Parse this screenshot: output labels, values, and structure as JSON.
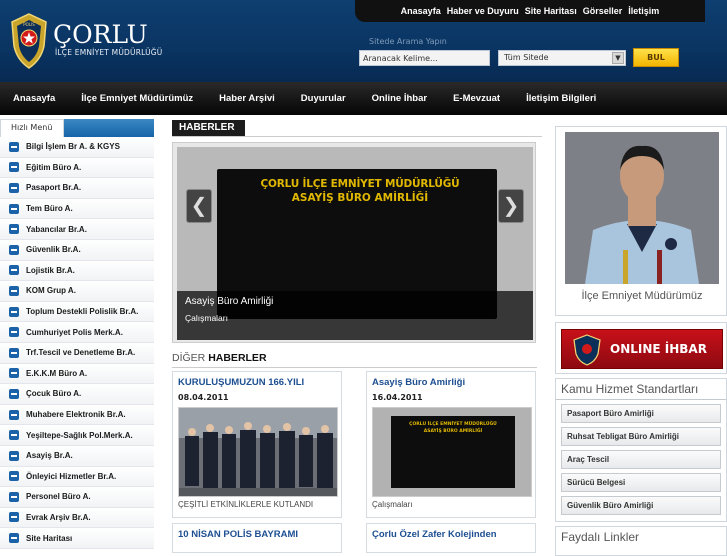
{
  "header": {
    "title": "ÇORLU",
    "subtitle": "İLÇE EMNİYET MÜDÜRLÜĞÜ",
    "badge_text": "POLIS"
  },
  "top_nav": [
    "Anasayfa",
    "Haber ve Duyuru",
    "Site Haritası",
    "Görseller",
    "İletişim"
  ],
  "search": {
    "label": "Sitede Arama Yapın",
    "input_value": "Aranacak Kelime...",
    "scope_selected": "Tüm Sitede",
    "button_label": "BUL"
  },
  "main_nav": [
    "Anasayfa",
    "İlçe Emniyet Müdürümüz",
    "Haber Arşivi",
    "Duyurular",
    "Online İhbar",
    "E-Mevzuat",
    "İletişim Bilgileri"
  ],
  "sidebar": {
    "tab_label": "Hızlı Menü",
    "items": [
      "Bilgi İşlem Br A. & KGYS",
      "Eğitim Büro A.",
      "Pasaport Br.A.",
      "Tem Büro A.",
      "Yabancılar Br.A.",
      "Güvenlik Br.A.",
      "Lojistik Br.A.",
      "KOM Grup A.",
      "Toplum Destekli Polislik Br.A.",
      "Cumhuriyet Polis Merk.A.",
      "Trf.Tescil ve Denetleme Br.A.",
      "E.K.K.M Büro A.",
      "Çocuk Büro A.",
      "Muhabere Elektronik Br.A.",
      "Yeşiltepe-Sağlık Pol.Merk.A.",
      "Asayiş Br.A.",
      "Önleyici Hizmetler Br.A.",
      "Personel Büro A.",
      "Evrak Arşiv Br.A.",
      "Site Haritası"
    ]
  },
  "news": {
    "section_title": "HABERLER",
    "slide": {
      "screen_line1": "ÇORLU İLÇE EMNİYET MÜDÜRLÜĞÜ",
      "screen_line2": "ASAYİŞ BÜRO AMİRLİĞİ",
      "title": "Asayiş Büro Amirliği",
      "subtitle": "Çalışmaları",
      "prev_icon": "❮",
      "next_icon": "❯"
    },
    "other_prefix": "DİĞER",
    "other_title": "HABERLER",
    "cards": [
      {
        "title": "KURULUŞUMUZUN 166.YILI",
        "date": "08.04.2011",
        "caption": "ÇEŞİTLİ ETKİNLİKLERLE KUTLANDI"
      },
      {
        "title": "Asayiş Büro Amirliği",
        "date": "16.04.2011",
        "caption": "Çalışmaları",
        "screen_line1": "ÇORLU İLÇE EMNİYET MÜDÜRLÜĞÜ",
        "screen_line2": "ASAYİŞ BÜRO AMİRLİĞİ"
      },
      {
        "title": "10 NİSAN POLİS BAYRAMI"
      },
      {
        "title": "Çorlu Özel Zafer Kolejinden"
      }
    ]
  },
  "right": {
    "chief_caption": "İlçe Emniyet Müdürümüz",
    "ihbar_label": "ONLINE İHBAR",
    "standards_title": "Kamu Hizmet Standartları",
    "standards": [
      "Pasaport Büro Amirliği",
      "Ruhsat Tebligat Büro Amirliği",
      "Araç Tescil",
      "Sürücü Belgesi",
      "Güvenlik Büro Amirliği"
    ],
    "links_title": "Faydalı Linkler"
  },
  "colors": {
    "header_bg": "#0a3462",
    "nav_bg": "#111111",
    "accent": "#1c62a8",
    "search_button": "#f6c200"
  }
}
